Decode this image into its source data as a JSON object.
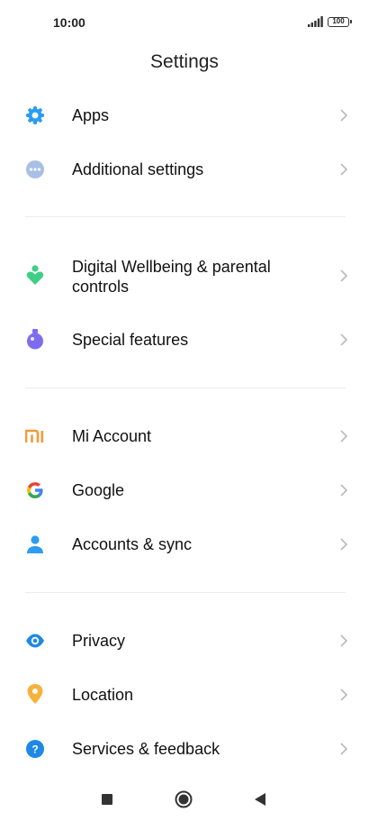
{
  "status_bar": {
    "time": "10:00",
    "battery": "100"
  },
  "header": {
    "title": "Settings"
  },
  "items": [
    {
      "label": "Apps"
    },
    {
      "label": "Additional settings"
    },
    {
      "label": "Digital Wellbeing & parental controls"
    },
    {
      "label": "Special features"
    },
    {
      "label": "Mi Account",
      "icon_text": "MI"
    },
    {
      "label": "Google"
    },
    {
      "label": "Accounts & sync"
    },
    {
      "label": "Privacy"
    },
    {
      "label": "Location"
    },
    {
      "label": "Services & feedback"
    }
  ],
  "colors": {
    "apps_icon": "#2b9cf2",
    "additional_icon": "#a9bfe6",
    "wellbeing_icon": "#3fcf84",
    "special_icon": "#7e6cf0",
    "mi_icon": "#f39a3a",
    "accounts_icon": "#2b9cf2",
    "privacy_icon": "#1e88e5",
    "location_icon": "#f6b23c",
    "services_icon": "#1e88e5",
    "chevron": "#b8b8b8"
  }
}
